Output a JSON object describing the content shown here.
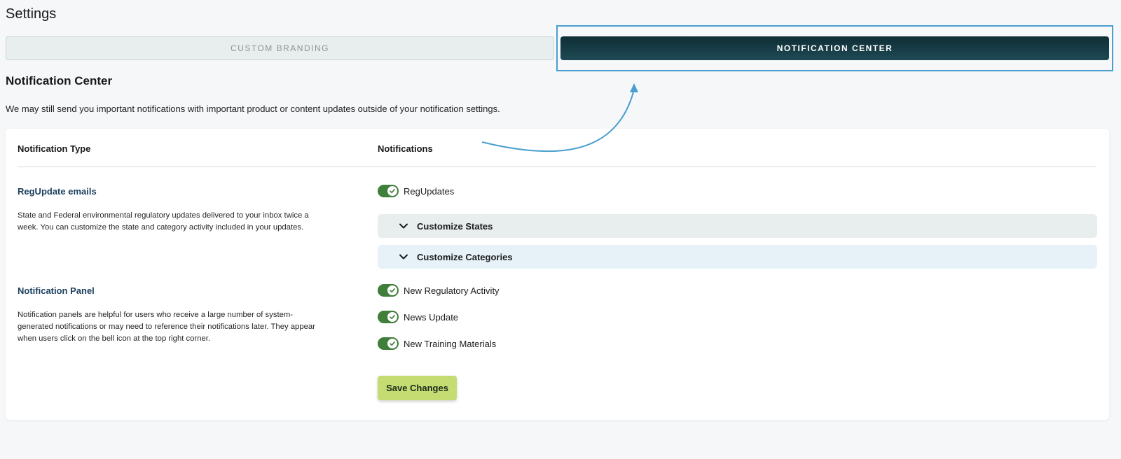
{
  "page": {
    "title": "Settings"
  },
  "tabs": [
    {
      "label": "CUSTOM BRANDING",
      "active": false
    },
    {
      "label": "NOTIFICATION CENTER",
      "active": true
    }
  ],
  "section": {
    "title": "Notification Center",
    "description": "We may still send you important notifications with important product or content updates outside of your notification settings."
  },
  "table": {
    "headers": {
      "type": "Notification Type",
      "notifications": "Notifications"
    },
    "rows": [
      {
        "title": "RegUpdate emails",
        "description": "State and Federal environmental regulatory updates delivered to your inbox twice a week. You can customize the state and category activity included in your updates.",
        "toggles": [
          {
            "label": "RegUpdates",
            "on": true
          }
        ],
        "accordions": [
          {
            "label": "Customize States"
          },
          {
            "label": "Customize Categories"
          }
        ]
      },
      {
        "title": "Notification Panel",
        "description": "Notification panels are helpful for users who receive a large number of system-generated notifications or may need to reference their notifications later. They appear when users click on the bell icon at the top right corner.",
        "toggles": [
          {
            "label": "New Regulatory Activity",
            "on": true
          },
          {
            "label": "News Update",
            "on": true
          },
          {
            "label": "New Training Materials",
            "on": true
          }
        ]
      }
    ]
  },
  "save_button": {
    "label": "Save Changes"
  },
  "colors": {
    "active_tab": "#123a44",
    "toggle_on": "#3f7f3a",
    "save_button": "#c5dc72",
    "annotation": "#4a9fcf",
    "type_title": "#1c3f5e"
  },
  "icons": {
    "toggle_check": "check-icon",
    "accordion": "chevron-down-icon",
    "annotation": "arrow-icon"
  }
}
